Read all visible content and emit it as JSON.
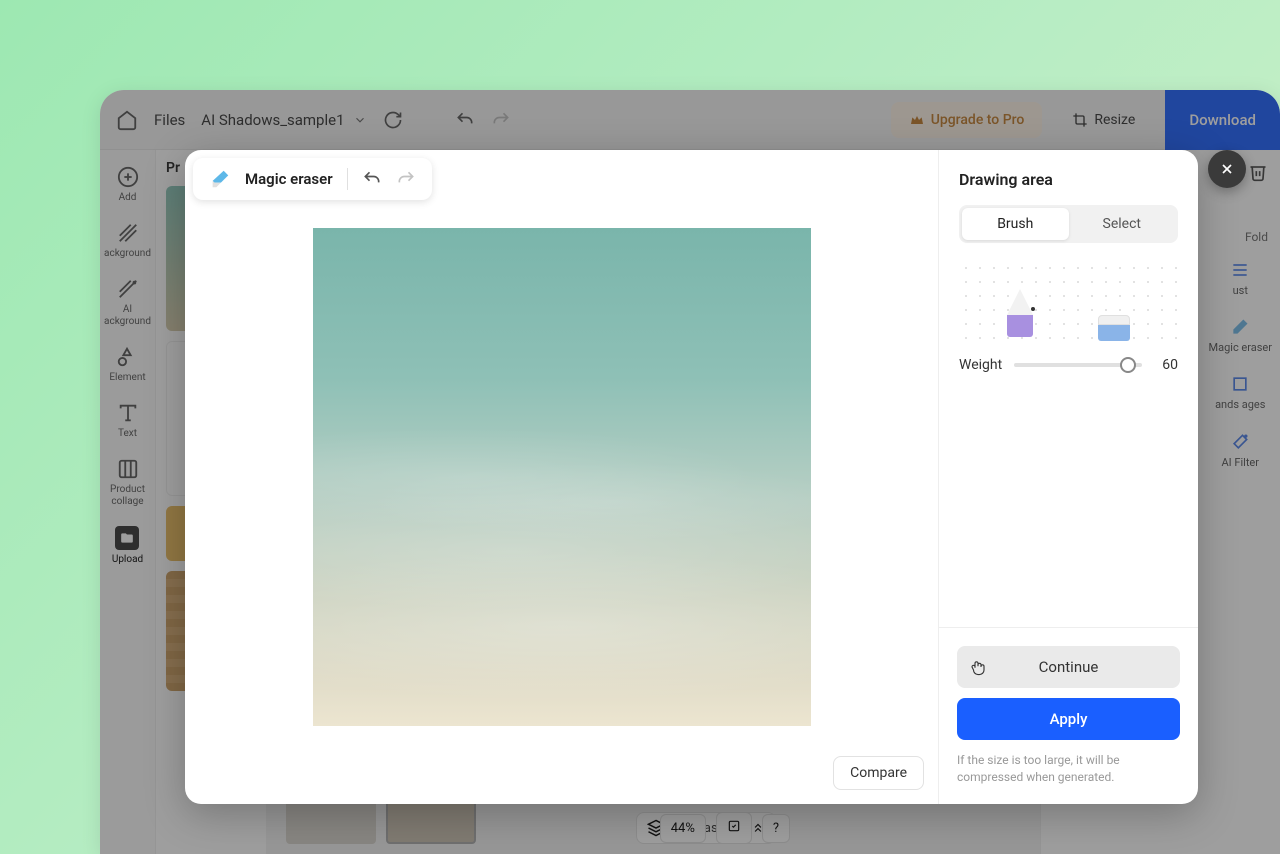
{
  "topbar": {
    "files_label": "Files",
    "filename": "AI Shadows_sample1",
    "upgrade_label": "Upgrade to Pro",
    "resize_label": "Resize",
    "download_label": "Download"
  },
  "rail": {
    "add": "Add",
    "background": "ackground",
    "ai_background": "AI ackground",
    "element": "Element",
    "text": "Text",
    "product_collage": "Product collage",
    "upload": "Upload"
  },
  "thumbs": {
    "label": "Pr"
  },
  "canvas": {
    "label": "Canvas 1/1",
    "zoom": "44%"
  },
  "right_panel": {
    "fold": "Fold",
    "adjust": "ust",
    "magic_eraser": "Magic eraser",
    "ands_ages": "ands ages",
    "ai_filter": "AI Filter"
  },
  "modal": {
    "title": "Magic eraser",
    "compare": "Compare",
    "drawing_area": "Drawing area",
    "brush": "Brush",
    "select": "Select",
    "weight_label": "Weight",
    "weight_value": "60",
    "continue": "Continue",
    "apply": "Apply",
    "note": "If the size is too large, it will be compressed when generated."
  }
}
